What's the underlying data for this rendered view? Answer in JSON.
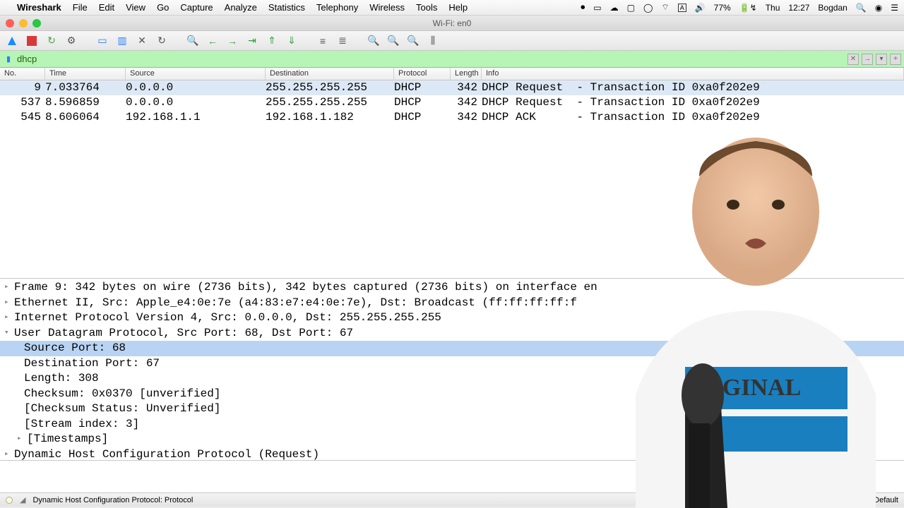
{
  "menubar": {
    "apple": "",
    "appname": "Wireshark",
    "items": [
      "File",
      "Edit",
      "View",
      "Go",
      "Capture",
      "Analyze",
      "Statistics",
      "Telephony",
      "Wireless",
      "Tools",
      "Help"
    ],
    "right": {
      "battery": "77%",
      "day": "Thu",
      "time": "12:27",
      "user": "Bogdan"
    }
  },
  "window": {
    "title": "Wi-Fi: en0"
  },
  "filter": {
    "value": "dhcp"
  },
  "columns": {
    "no": "No.",
    "time": "Time",
    "source": "Source",
    "destination": "Destination",
    "protocol": "Protocol",
    "length": "Length",
    "info": "Info"
  },
  "packets": [
    {
      "no": "9",
      "time": "7.033764",
      "src": "0.0.0.0",
      "dst": "255.255.255.255",
      "proto": "DHCP",
      "len": "342",
      "info": "DHCP Request  - Transaction ID 0xa0f202e9",
      "sel": true
    },
    {
      "no": "537",
      "time": "8.596859",
      "src": "0.0.0.0",
      "dst": "255.255.255.255",
      "proto": "DHCP",
      "len": "342",
      "info": "DHCP Request  - Transaction ID 0xa0f202e9",
      "sel": false
    },
    {
      "no": "545",
      "time": "8.606064",
      "src": "192.168.1.1",
      "dst": "192.168.1.182",
      "proto": "DHCP",
      "len": "342",
      "info": "DHCP ACK      - Transaction ID 0xa0f202e9",
      "sel": false
    }
  ],
  "details": {
    "frame": "Frame 9: 342 bytes on wire (2736 bits), 342 bytes captured (2736 bits) on interface en",
    "eth": "Ethernet II, Src: Apple_e4:0e:7e (a4:83:e7:e4:0e:7e), Dst: Broadcast (ff:ff:ff:ff:f",
    "ip": "Internet Protocol Version 4, Src: 0.0.0.0, Dst: 255.255.255.255",
    "udp": "User Datagram Protocol, Src Port: 68, Dst Port: 67",
    "udp_children": {
      "srcport": "Source Port: 68",
      "dstport": "Destination Port: 67",
      "length": "Length: 308",
      "cksum": "Checksum: 0x0370 [unverified]",
      "ckstat": "[Checksum Status: Unverified]",
      "stream": "[Stream index: 3]",
      "ts": "[Timestamps]"
    },
    "dhcp": "Dynamic Host Configuration Protocol (Request)"
  },
  "status": {
    "text": "Dynamic Host Configuration Protocol: Protocol",
    "profile_label": "Profile: Default"
  },
  "icons": {
    "fin": "◢",
    "stop": "■",
    "restart": "↻",
    "gear": "⚙",
    "folder": "📂",
    "save": "▥",
    "close": "✕",
    "reload": "↻",
    "find": "🔍",
    "back": "←",
    "fwd": "→",
    "jump": "⇥",
    "up": "↑",
    "down": "↓",
    "top": "⇑",
    "bot": "⇓",
    "zin": "🔍+",
    "zout": "🔍-",
    "z1": "🔍=",
    "cols": "▯▯"
  }
}
